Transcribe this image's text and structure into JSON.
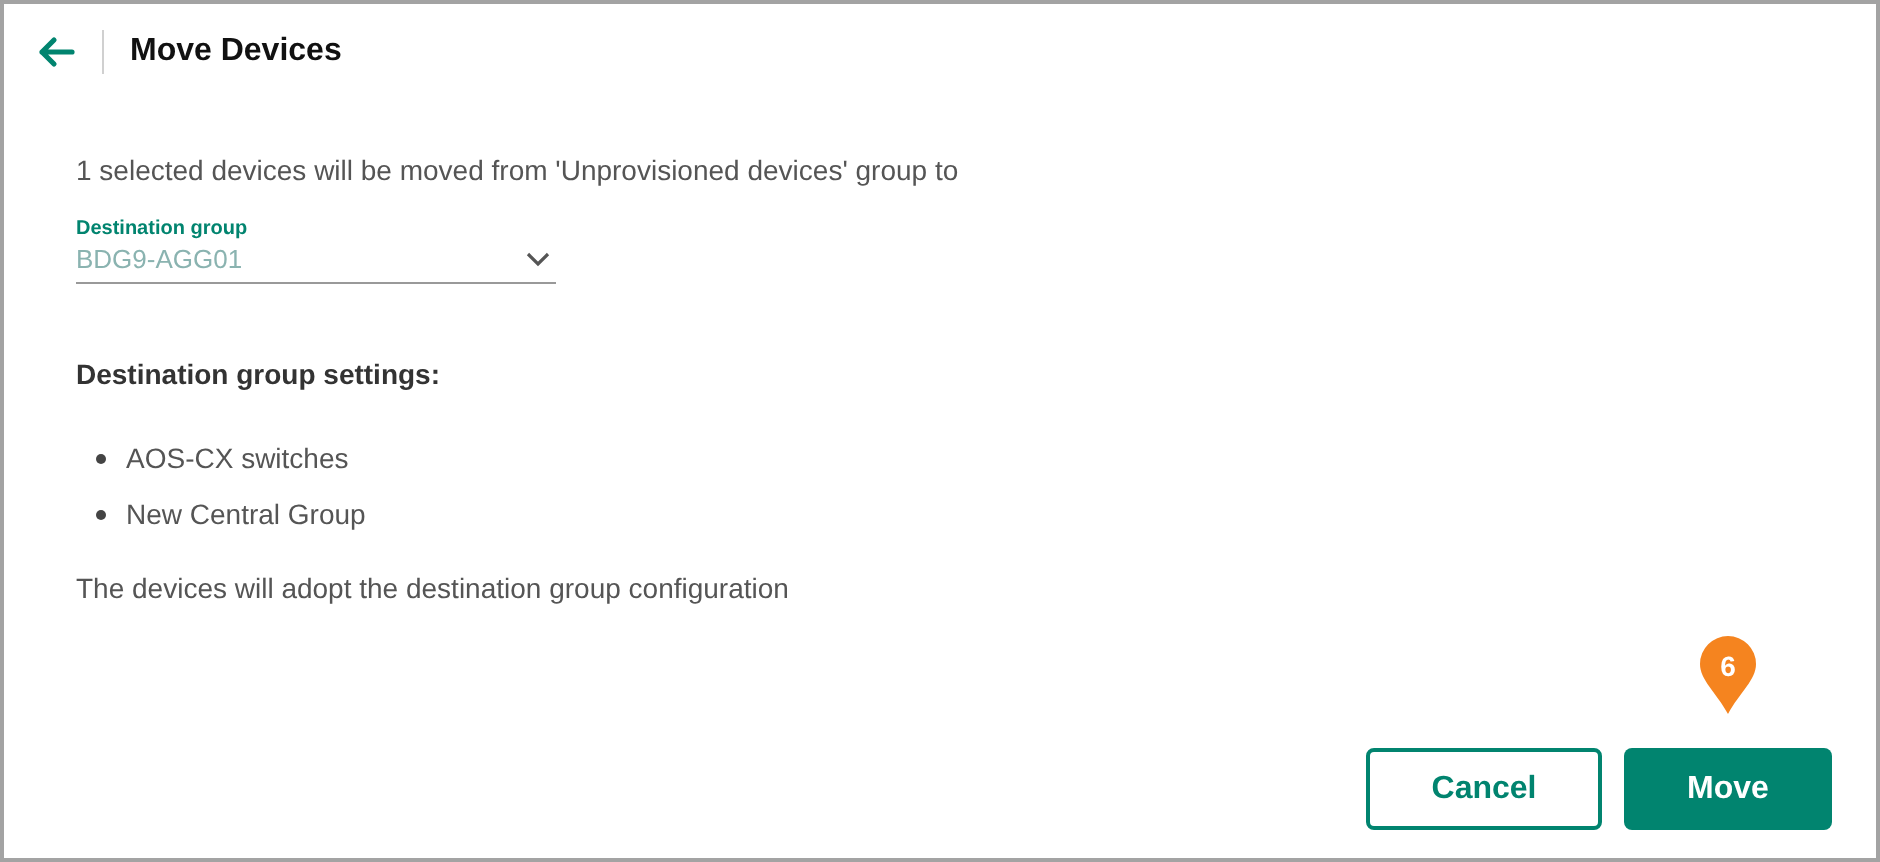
{
  "header": {
    "title": "Move Devices"
  },
  "message": "1 selected devices will be moved from 'Unprovisioned devices' group to",
  "destination_field": {
    "label": "Destination group",
    "value": "BDG9-AGG01"
  },
  "settings": {
    "heading": "Destination group settings:",
    "items": [
      "AOS-CX switches",
      "New Central Group"
    ]
  },
  "note": "The devices will adopt the destination group configuration",
  "step_marker": "6",
  "buttons": [
    {
      "label": "Cancel",
      "kind": "secondary"
    },
    {
      "label": "Move",
      "kind": "primary"
    }
  ]
}
